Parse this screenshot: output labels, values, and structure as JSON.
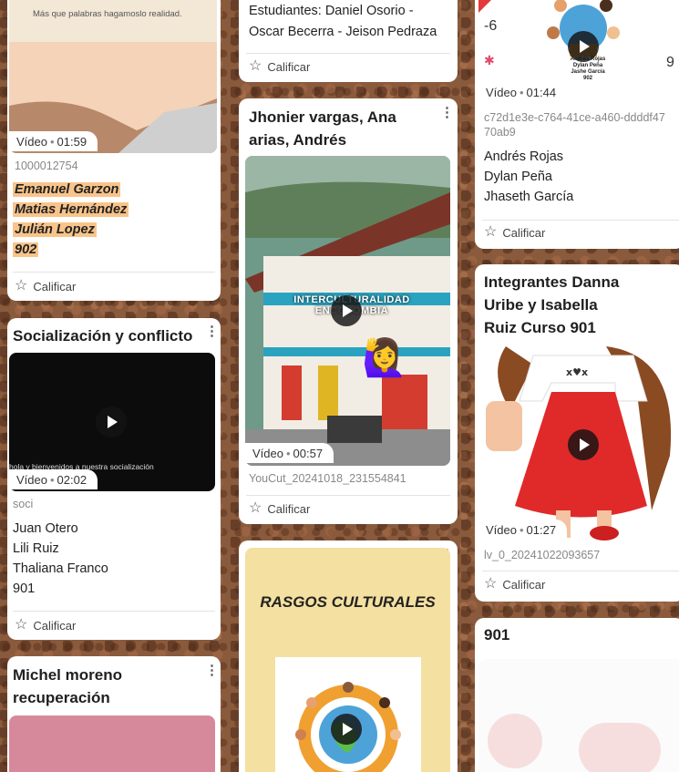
{
  "card1": {
    "thumb_text": "Más que palabras hagamoslo realidad.",
    "badge_kind": "Vídeo",
    "duration": "01:59",
    "filename": "1000012754",
    "lines": [
      "Emanuel Garzon",
      "Matias Hernández",
      "Julián Lopez",
      "902"
    ],
    "rate_label": "Calificar"
  },
  "card2": {
    "title": "Socialización y conflicto",
    "caption": "hola y bienvenidos a nuestra socialización",
    "badge_kind": "Vídeo",
    "duration": "02:02",
    "filename": "soci",
    "lines": [
      "Juan Otero",
      "Lili Ruiz",
      "Thaliana Franco",
      "901"
    ],
    "rate_label": "Calificar"
  },
  "card3": {
    "title": "Michel moreno recuperación"
  },
  "card4": {
    "lines": [
      "Estudiantes: Daniel Osorio -",
      "Oscar Becerra - Jeison Pedraza"
    ],
    "rate_label": "Calificar"
  },
  "card5": {
    "title": "Jhonier vargas, Ana arias, Andrés Romero",
    "overlay_text": "INTERCULTURALIDAD ENCOLOMBIA",
    "emoji": "🙋‍♀️",
    "badge_kind": "Vídeo",
    "duration": "00:57",
    "filename": "YouCut_20241018_231554841",
    "rate_label": "Calificar"
  },
  "card6": {
    "thumb_title": "RASGOS CULTURALES"
  },
  "card7": {
    "thumb_names": [
      "Andrés Rojas",
      "Dylan Peña",
      "Jashe García",
      "902"
    ],
    "badge_kind": "Vídeo",
    "duration": "01:44",
    "filename": "c72d1e3e-c764-41ce-a460-ddddf4770ab9",
    "lines": [
      "Andrés Rojas",
      "Dylan Peña",
      "Jhaseth García"
    ],
    "rate_label": "Calificar"
  },
  "card8": {
    "title": "Integrantes Danna Uribe y Isabella Ruiz Curso 901",
    "badge_kind": "Vídeo",
    "duration": "01:27",
    "filename": "lv_0_20241022093657",
    "rate_label": "Calificar"
  },
  "card9": {
    "title": "901"
  },
  "colors": {
    "highlight": "#f9c48a",
    "board_bg": "#8a5a3c"
  }
}
